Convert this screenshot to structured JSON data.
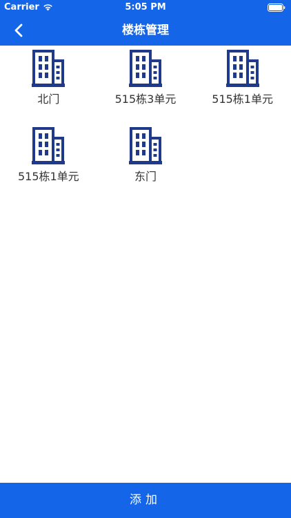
{
  "status_bar": {
    "carrier": "Carrier",
    "time": "5:05 PM"
  },
  "nav": {
    "title": "楼栋管理",
    "back_icon": "chevron-left-icon"
  },
  "colors": {
    "primary": "#1565e9",
    "icon": "#1f3a8a",
    "text": "#333333"
  },
  "buildings": [
    {
      "label": "北门",
      "icon": "building-icon"
    },
    {
      "label": "515栋3单元",
      "icon": "building-icon"
    },
    {
      "label": "515栋1单元",
      "icon": "building-icon"
    },
    {
      "label": "515栋1单元",
      "icon": "building-icon"
    },
    {
      "label": "东门",
      "icon": "building-icon"
    }
  ],
  "footer": {
    "add_label": "添加"
  }
}
